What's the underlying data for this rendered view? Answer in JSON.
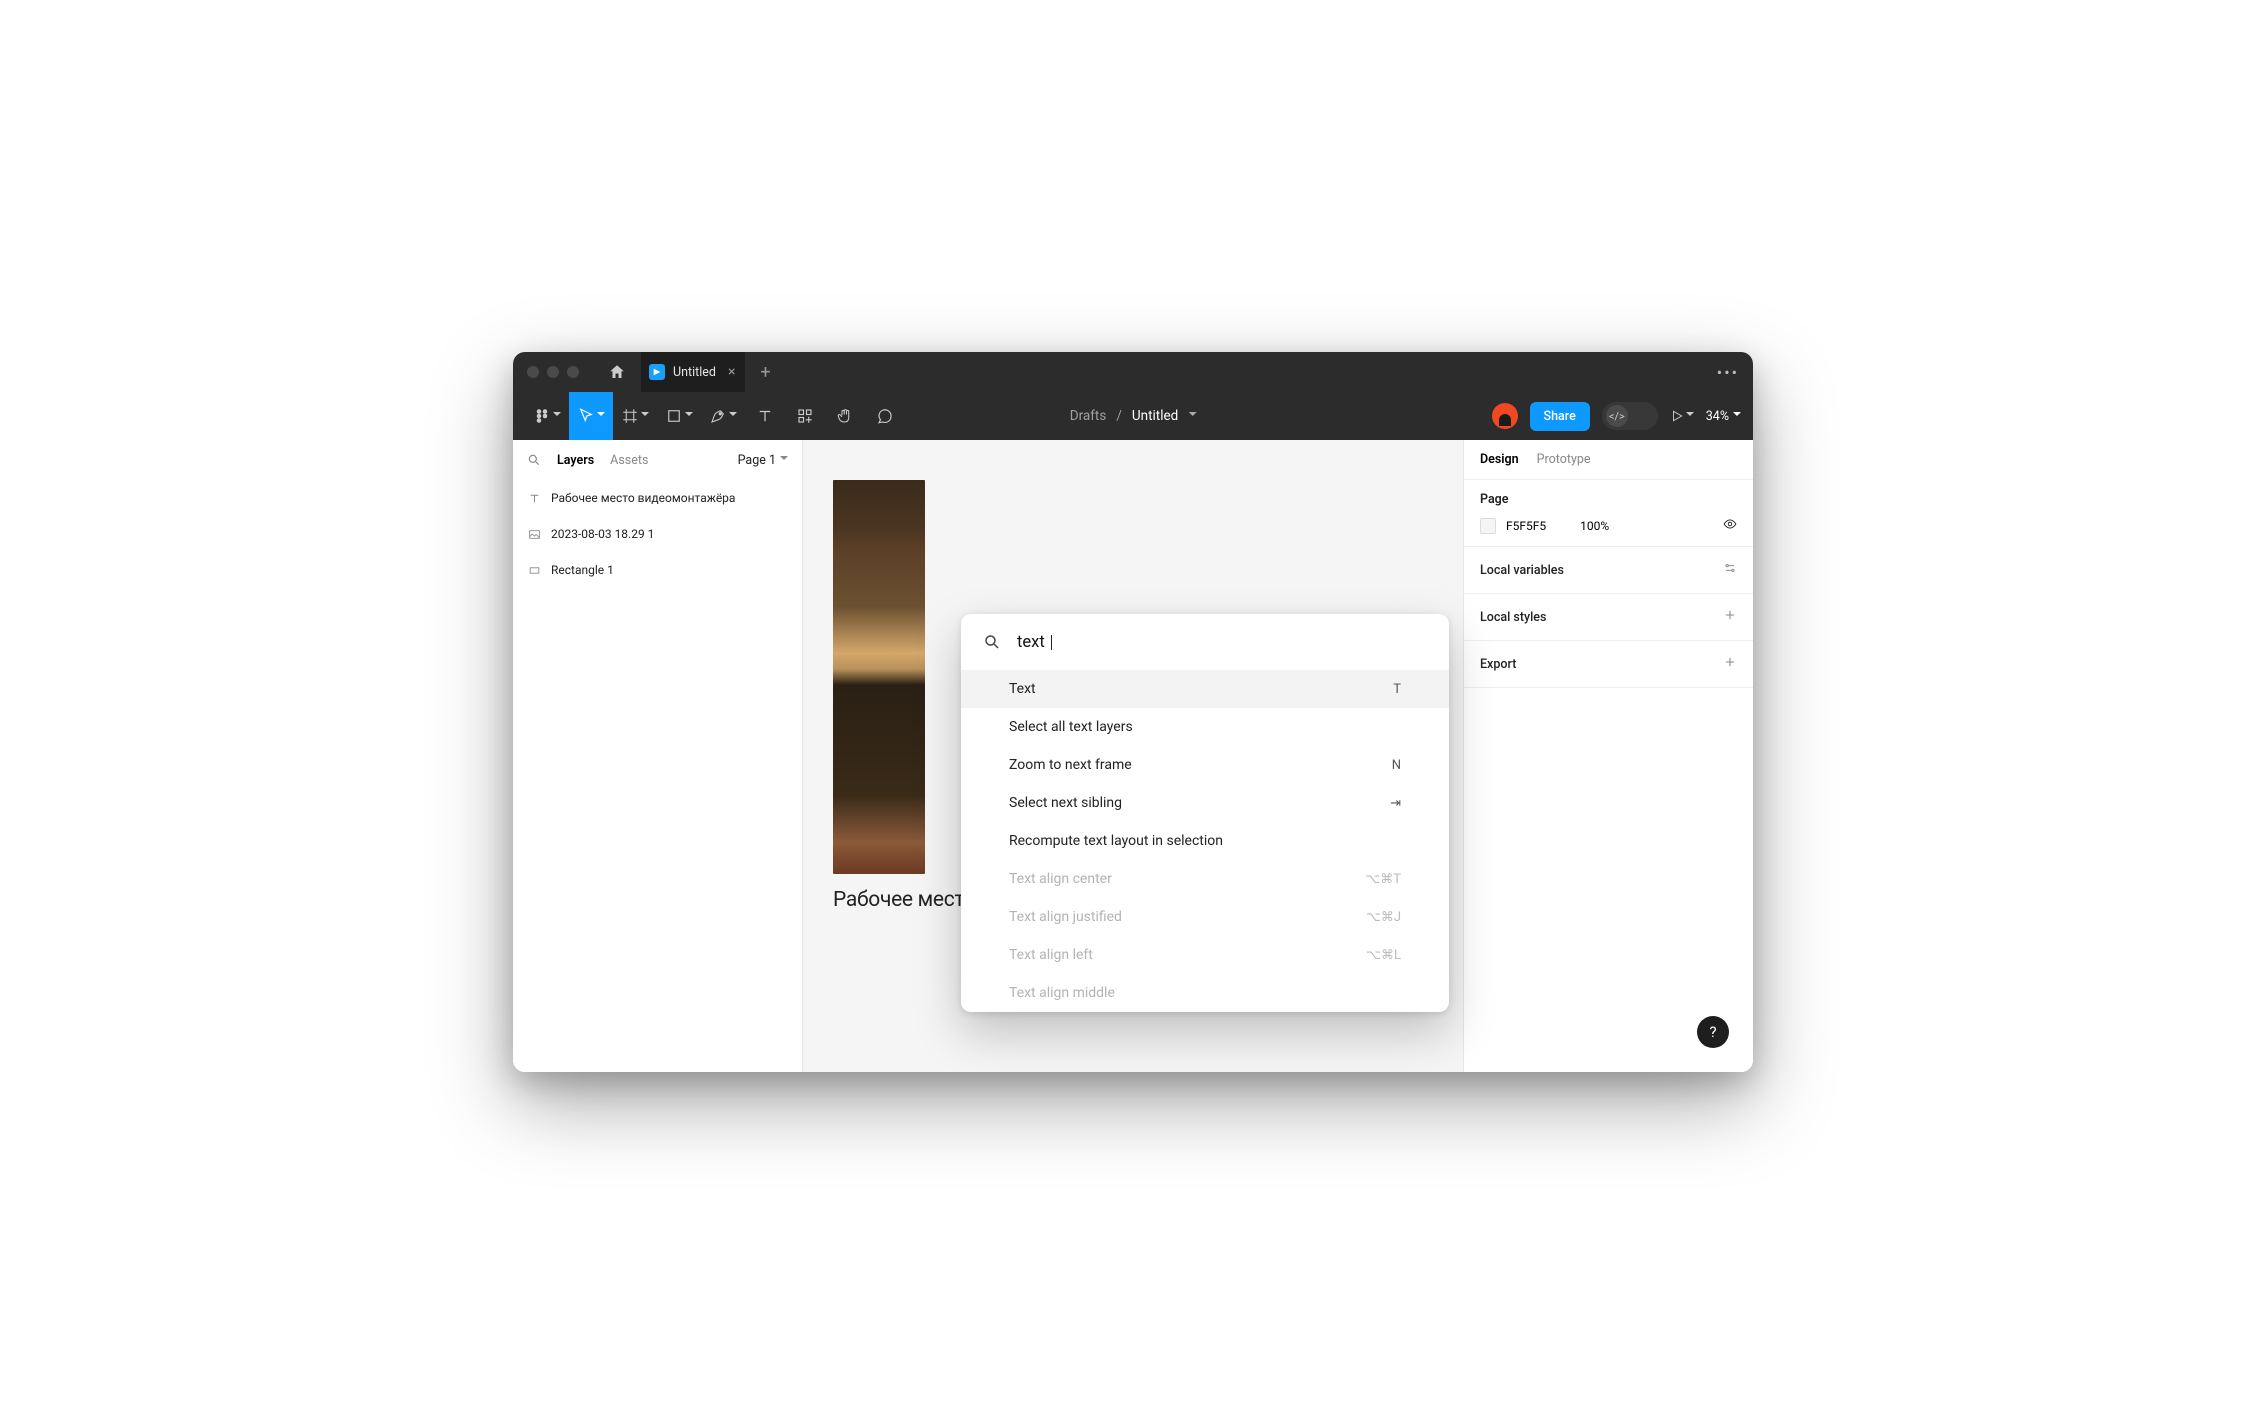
{
  "titlebar": {
    "file_tab_name": "Untitled"
  },
  "toolbar": {
    "breadcrumb_parent": "Drafts",
    "breadcrumb_sep": "/",
    "breadcrumb_title": "Untitled",
    "share_label": "Share",
    "zoom_label": "34%"
  },
  "left_panel": {
    "tabs": {
      "layers": "Layers",
      "assets": "Assets"
    },
    "page_label": "Page 1",
    "layers": [
      {
        "icon": "text",
        "name": "Рабочее место видеомонтажёра"
      },
      {
        "icon": "image",
        "name": "2023-08-03 18.29 1"
      },
      {
        "icon": "rect",
        "name": "Rectangle 1"
      }
    ]
  },
  "palette": {
    "query": "text",
    "items": [
      {
        "label": "Text",
        "shortcut": "T",
        "selected": true,
        "disabled": false
      },
      {
        "label": "Select all text layers",
        "shortcut": "",
        "selected": false,
        "disabled": false
      },
      {
        "label": "Zoom to next frame",
        "shortcut": "N",
        "selected": false,
        "disabled": false
      },
      {
        "label": "Select next sibling",
        "shortcut": "⇥",
        "selected": false,
        "disabled": false
      },
      {
        "label": "Recompute text layout in selection",
        "shortcut": "",
        "selected": false,
        "disabled": false
      },
      {
        "label": "Text align center",
        "shortcut": "⌥⌘T",
        "selected": false,
        "disabled": true
      },
      {
        "label": "Text align justified",
        "shortcut": "⌥⌘J",
        "selected": false,
        "disabled": true
      },
      {
        "label": "Text align left",
        "shortcut": "⌥⌘L",
        "selected": false,
        "disabled": true
      },
      {
        "label": "Text align middle",
        "shortcut": "",
        "selected": false,
        "disabled": true
      }
    ]
  },
  "canvas": {
    "text_layer": "Рабочее место видеомонтажёра"
  },
  "right_panel": {
    "tabs": {
      "design": "Design",
      "prototype": "Prototype"
    },
    "page_section_title": "Page",
    "page_fill_hex": "F5F5F5",
    "page_fill_opacity": "100%",
    "local_variables": "Local variables",
    "local_styles": "Local styles",
    "export": "Export"
  },
  "help": "?"
}
